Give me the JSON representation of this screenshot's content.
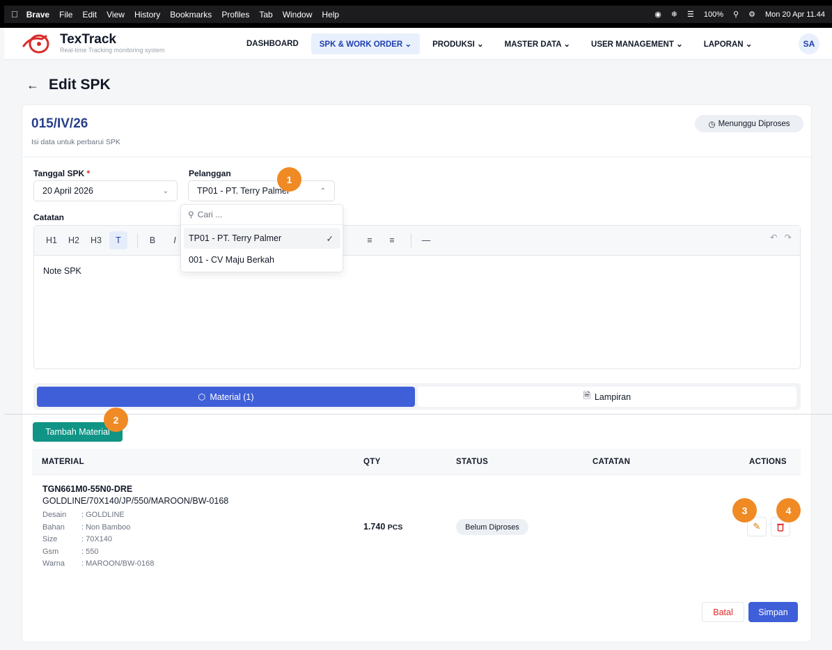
{
  "menubar": {
    "app": "Brave",
    "items": [
      "File",
      "Edit",
      "View",
      "History",
      "Bookmarks",
      "Profiles",
      "Tab",
      "Window",
      "Help"
    ],
    "battery": "100%",
    "clock": "Mon 20 Apr 11.44"
  },
  "header": {
    "brand": "TexTrack",
    "tagline": "Real-time Tracking monitoring system",
    "nav": [
      "DASHBOARD",
      "SPK & WORK ORDER",
      "PRODUKSI",
      "MASTER DATA",
      "USER MANAGEMENT",
      "LAPORAN"
    ],
    "avatar": "SA"
  },
  "page": {
    "title": "Edit SPK",
    "spk_number": "015/IV/26",
    "subtitle": "Isi data untuk perbarui SPK",
    "status": "Menunggu Diproses"
  },
  "form": {
    "date_label": "Tanggal SPK",
    "date_required": "*",
    "date_value": "20 April 2026",
    "customer_label": "Pelanggan",
    "customer_value": "TP01 - PT. Terry Palmer",
    "notes_label": "Catatan",
    "notes_value": "Note SPK"
  },
  "dropdown": {
    "search_placeholder": "Cari ...",
    "options": [
      "TP01 - PT. Terry Palmer",
      "001 - CV Maju Berkah"
    ]
  },
  "editor": {
    "buttons": [
      "H1",
      "H2",
      "H3",
      "T",
      "B",
      "I"
    ]
  },
  "tabs": {
    "material": "Material (1)",
    "attachments": "Lampiran"
  },
  "materials": {
    "add_button": "Tambah Material",
    "headers": [
      "MATERIAL",
      "QTY",
      "STATUS",
      "CATATAN",
      "ACTIONS"
    ],
    "rows": [
      {
        "code": "TGN661M0-55N0-DRE",
        "name": "GOLDLINE/70X140/JP/550/MAROON/BW-0168",
        "specs": [
          {
            "key": "Desain",
            "value": ": GOLDLINE"
          },
          {
            "key": "Bahan",
            "value": ": Non Bamboo"
          },
          {
            "key": "Size",
            "value": ": 70X140"
          },
          {
            "key": "Gsm",
            "value": ": 550"
          },
          {
            "key": "Warna",
            "value": ": MAROON/BW-0168"
          }
        ],
        "qty": "1.740",
        "unit": "PCS",
        "status": "Belum Diproses"
      }
    ]
  },
  "footer": {
    "cancel": "Batal",
    "save": "Simpan"
  },
  "markers": [
    "1",
    "2",
    "3",
    "4"
  ],
  "colors": {
    "primary": "#3f5fd8",
    "teal": "#0f9485",
    "marker": "#f08a24",
    "danger": "#dc2626"
  }
}
